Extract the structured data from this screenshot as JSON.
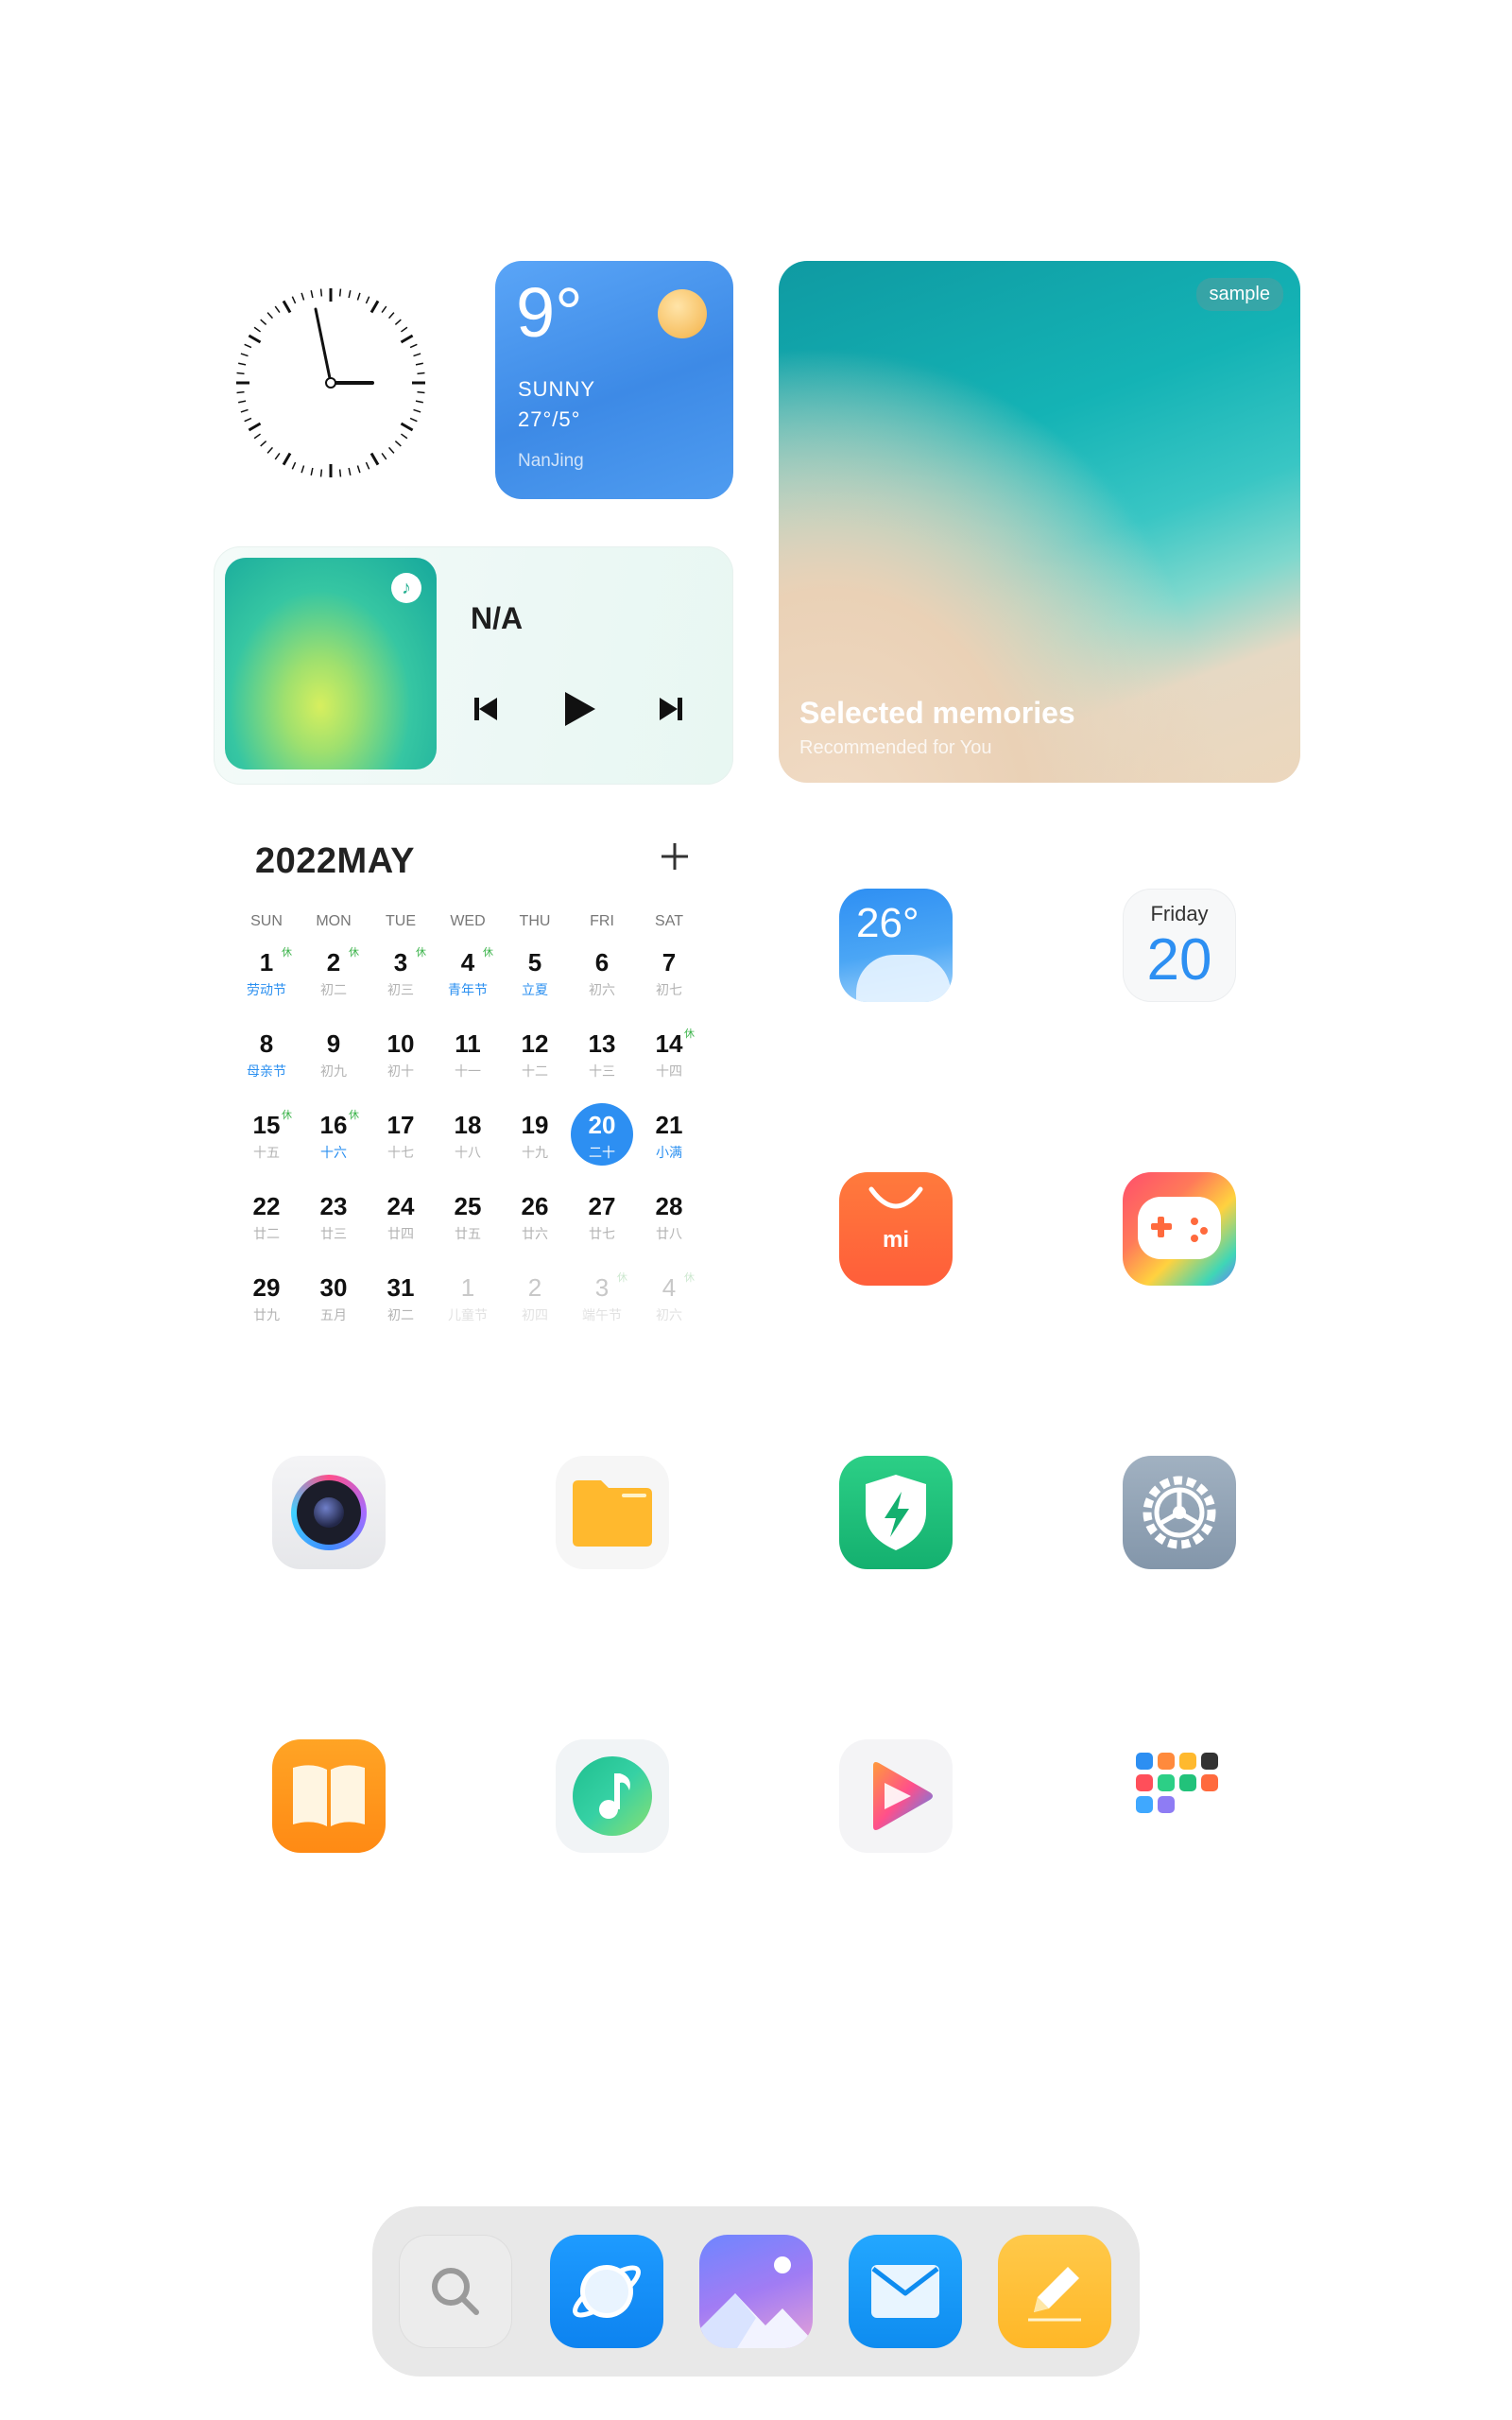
{
  "weather": {
    "temperature": "9°",
    "condition": "SUNNY",
    "range": "27°/5°",
    "city": "NanJing"
  },
  "music": {
    "title": "N/A"
  },
  "memories": {
    "tag": "sample",
    "title": "Selected memories",
    "subtitle": "Recommended for You"
  },
  "calendar": {
    "title": "2022MAY",
    "weekdays": [
      "SUN",
      "MON",
      "TUE",
      "WED",
      "THU",
      "FRI",
      "SAT"
    ],
    "rest_mark": "休",
    "days": [
      {
        "n": "1",
        "l": "劳动节",
        "blue": true,
        "rest": true
      },
      {
        "n": "2",
        "l": "初二",
        "rest": true
      },
      {
        "n": "3",
        "l": "初三",
        "rest": true
      },
      {
        "n": "4",
        "l": "青年节",
        "blue": true,
        "rest": true
      },
      {
        "n": "5",
        "l": "立夏",
        "blue": true
      },
      {
        "n": "6",
        "l": "初六"
      },
      {
        "n": "7",
        "l": "初七"
      },
      {
        "n": "8",
        "l": "母亲节",
        "blue": true
      },
      {
        "n": "9",
        "l": "初九"
      },
      {
        "n": "10",
        "l": "初十"
      },
      {
        "n": "11",
        "l": "十一"
      },
      {
        "n": "12",
        "l": "十二"
      },
      {
        "n": "13",
        "l": "十三"
      },
      {
        "n": "14",
        "l": "十四",
        "rest": true
      },
      {
        "n": "15",
        "l": "十五",
        "rest": true
      },
      {
        "n": "16",
        "l": "十六",
        "blue": true,
        "rest": true
      },
      {
        "n": "17",
        "l": "十七"
      },
      {
        "n": "18",
        "l": "十八"
      },
      {
        "n": "19",
        "l": "十九"
      },
      {
        "n": "20",
        "l": "二十",
        "today": true
      },
      {
        "n": "21",
        "l": "小满",
        "blue": true
      },
      {
        "n": "22",
        "l": "廿二"
      },
      {
        "n": "23",
        "l": "廿三"
      },
      {
        "n": "24",
        "l": "廿四"
      },
      {
        "n": "25",
        "l": "廿五"
      },
      {
        "n": "26",
        "l": "廿六"
      },
      {
        "n": "27",
        "l": "廿七"
      },
      {
        "n": "28",
        "l": "廿八"
      },
      {
        "n": "29",
        "l": "廿九"
      },
      {
        "n": "30",
        "l": "五月"
      },
      {
        "n": "31",
        "l": "初二"
      },
      {
        "n": "1",
        "l": "儿童节",
        "dim": true
      },
      {
        "n": "2",
        "l": "初四",
        "dim": true
      },
      {
        "n": "3",
        "l": "端午节",
        "dim": true,
        "rest": true
      },
      {
        "n": "4",
        "l": "初六",
        "dim": true,
        "rest": true
      }
    ]
  },
  "apps": {
    "weather_temp": "26°",
    "calendar_weekday": "Friday",
    "calendar_day": "20",
    "store_logo": "mi"
  },
  "colors": {
    "accent": "#2d8ff2",
    "weather_widget": "#4a95ed",
    "store": "#ff6a3d",
    "security": "#22c27a",
    "settings": "#8fa3b5",
    "books": "#ff9a1f",
    "files": "#ffb92e",
    "dock": "#e8e8e8"
  }
}
